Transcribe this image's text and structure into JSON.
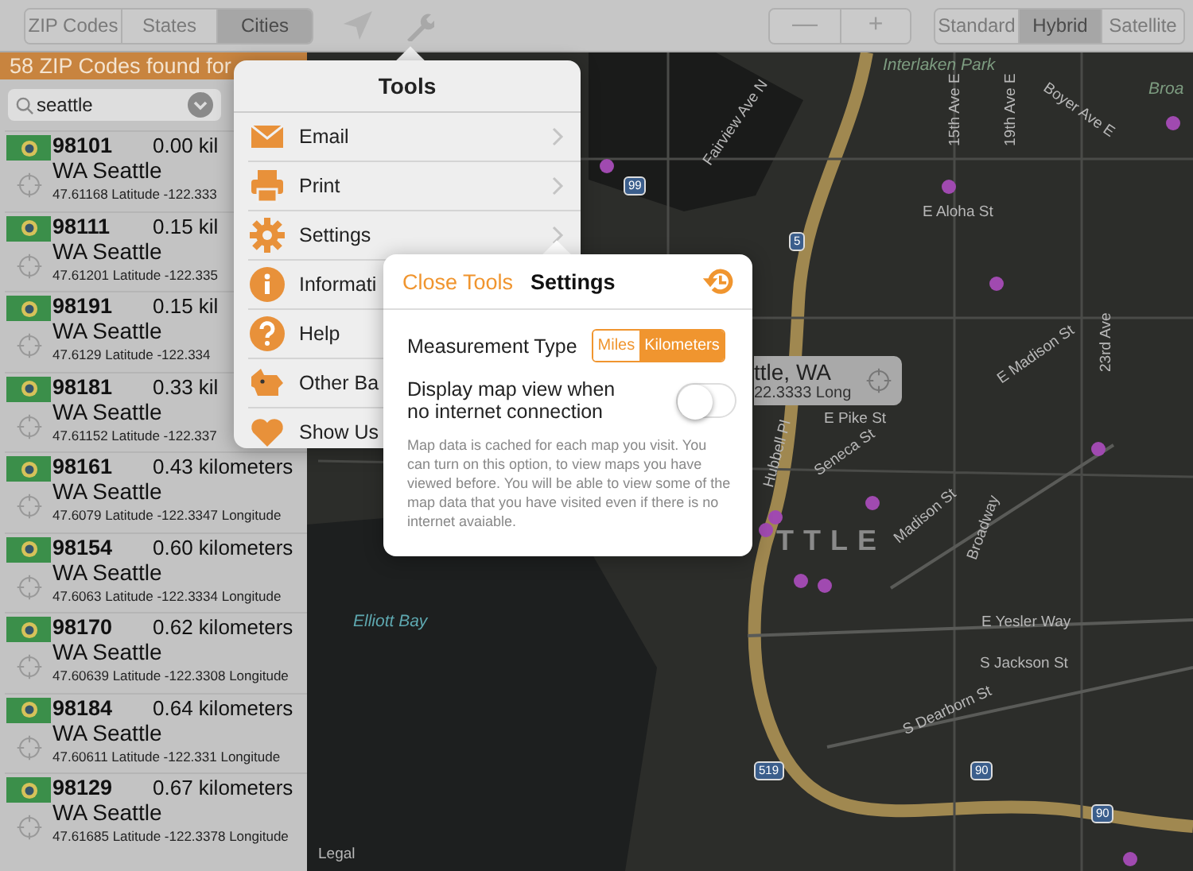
{
  "toolbar": {
    "search_types": [
      {
        "label": "ZIP Codes",
        "selected": false
      },
      {
        "label": "States",
        "selected": false
      },
      {
        "label": "Cities",
        "selected": true
      }
    ],
    "zoom_buttons": [
      "—",
      "+"
    ],
    "map_types": [
      {
        "label": "Standard",
        "selected": false
      },
      {
        "label": "Hybrid",
        "selected": true
      },
      {
        "label": "Satellite",
        "selected": false
      }
    ]
  },
  "results": {
    "header": "58 ZIP Codes found for",
    "search": {
      "value": "seattle"
    },
    "rows": [
      {
        "zip": "98101",
        "distance": "0.00 kil",
        "city": "WA Seattle",
        "coords": "47.61168 Latitude -122.333"
      },
      {
        "zip": "98111",
        "distance": "0.15 kil",
        "city": "WA Seattle",
        "coords": "47.61201 Latitude -122.335"
      },
      {
        "zip": "98191",
        "distance": "0.15 kil",
        "city": "WA Seattle",
        "coords": "47.6129 Latitude -122.334"
      },
      {
        "zip": "98181",
        "distance": "0.33 kil",
        "city": "WA Seattle",
        "coords": "47.61152 Latitude -122.337"
      },
      {
        "zip": "98161",
        "distance": "0.43 kilometers",
        "city": "WA Seattle",
        "coords": "47.6079 Latitude -122.3347 Longitude"
      },
      {
        "zip": "98154",
        "distance": "0.60 kilometers",
        "city": "WA Seattle",
        "coords": "47.6063 Latitude -122.3334 Longitude"
      },
      {
        "zip": "98170",
        "distance": "0.62 kilometers",
        "city": "WA Seattle",
        "coords": "47.60639 Latitude -122.3308 Longitude"
      },
      {
        "zip": "98184",
        "distance": "0.64 kilometers",
        "city": "WA Seattle",
        "coords": "47.60611 Latitude -122.331 Longitude"
      },
      {
        "zip": "98129",
        "distance": "0.67 kilometers",
        "city": "WA Seattle",
        "coords": "47.61685 Latitude -122.3378 Longitude"
      }
    ]
  },
  "map": {
    "labels": [
      "Interlaken Park",
      "Boyer Ave E",
      "Broa",
      "Fairview Ave N",
      "15th Ave E",
      "19th Ave E",
      "E Aloha St",
      "E Madison St",
      "23rd Ave",
      "E Pike St",
      "Seneca St",
      "Madison St",
      "Broadway",
      "Hubbell Pl",
      "TTLE",
      "Elliott Bay",
      "E Yesler Way",
      "S Jackson St",
      "S Dearborn St",
      "Legal"
    ],
    "shields": [
      "99",
      "5",
      "519",
      "90",
      "90"
    ],
    "callout": {
      "title": "ttle, WA",
      "subtitle": "22.3333 Long"
    }
  },
  "tools_popover": {
    "title": "Tools",
    "items": [
      {
        "label": "Email",
        "chevron": true
      },
      {
        "label": "Print",
        "chevron": true
      },
      {
        "label": "Settings",
        "chevron": true
      },
      {
        "label": "Informati"
      },
      {
        "label": "Help"
      },
      {
        "label": "Other Ba"
      },
      {
        "label": "Show Us"
      }
    ]
  },
  "settings_popover": {
    "close_label": "Close Tools",
    "title": "Settings",
    "measurement": {
      "label": "Measurement Type",
      "options": [
        {
          "label": "Miles",
          "selected": false
        },
        {
          "label": "Kilometers",
          "selected": true
        }
      ]
    },
    "offline_toggle": {
      "label": "Display map view when no internet connection",
      "on": false
    },
    "note": "Map data is cached for each map you visit. You can turn on this option, to view maps you have viewed before. You will be able to view some of the map data that you have visited even if there is no internet avaiable."
  }
}
